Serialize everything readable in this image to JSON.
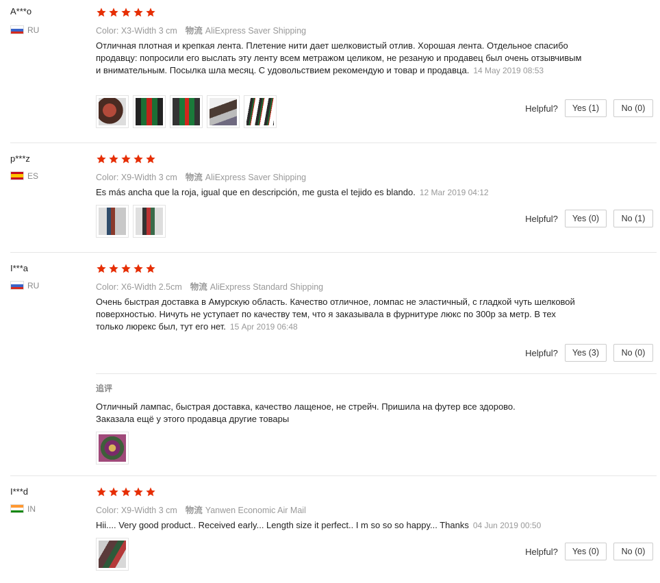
{
  "labels": {
    "helpful": "Helpful?",
    "logistics": "物流",
    "followup": "追评"
  },
  "colors": {
    "star": "#e62e04"
  },
  "reviews": [
    {
      "user": "A***o",
      "country": "RU",
      "rating": 5,
      "color": "Color: X3-Width 3 cm",
      "shipping": "AliExpress Saver Shipping",
      "text": "Отличная плотная и крепкая лента. Плетение нити дает шелковистый отлив. Хорошая лента. Отдельное спасибо продавцу: попросили его выслать эту ленту всем метражом целиком, не резаную и продавец был очень отзывчивым и внимательным. Посылка шла месяц. С удовольствием рекомендую и товар и продавца.",
      "date": "14 May 2019 08:53",
      "yes": "Yes (1)",
      "no": "No (0)",
      "photos": [
        "photo-1",
        "photo-2",
        "photo-3",
        "photo-4",
        "photo-5"
      ]
    },
    {
      "user": "p***z",
      "country": "ES",
      "rating": 5,
      "color": "Color: X9-Width 3 cm",
      "shipping": "AliExpress Saver Shipping",
      "text": "Es más ancha que la roja, igual que en descripción, me gusta el tejido es blando.",
      "date": "12 Mar 2019 04:12",
      "yes": "Yes (0)",
      "no": "No (1)",
      "photos": [
        "photo-1",
        "photo-2"
      ]
    },
    {
      "user": "I***a",
      "country": "RU",
      "rating": 5,
      "color": "Color: X6-Width 2.5cm",
      "shipping": "AliExpress Standard Shipping",
      "text": "Очень быстрая доставка в Амурскую область. Качество отличное, ломпас не эластичный, с гладкой чуть шелковой поверхностью. Ничуть не уступает по качеству тем, что я заказывала в фурнитуре люкс по 300р за метр. В тех только люрекс был, тут его нет.",
      "date": "15 Apr 2019 06:48",
      "yes": "Yes (3)",
      "no": "No (0)",
      "followup_line1": "Отличный лампас, быстрая доставка, качество лащеное, не стрейч. Пришила на футер все здорово.",
      "followup_line2": "Заказала ещё у этого продавца другие товары"
    },
    {
      "user": "I***d",
      "country": "IN",
      "rating": 5,
      "color": "Color: X9-Width 3 cm",
      "shipping": "Yanwen Economic Air Mail",
      "text": "Hii.... Very good product.. Received early... Length size it perfect.. I m so so so happy... Thanks",
      "date": "04 Jun 2019 00:50",
      "yes": "Yes (0)",
      "no": "No (0)"
    }
  ]
}
